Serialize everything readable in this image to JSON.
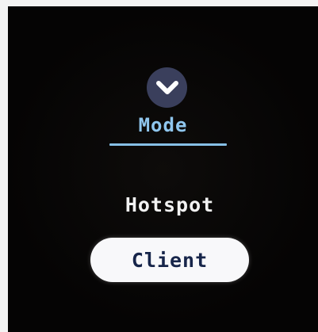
{
  "header": {
    "back_icon": "chevron-down-icon",
    "title": "Mode"
  },
  "options": [
    {
      "label": "Hotspot",
      "selected": false
    },
    {
      "label": "Client",
      "selected": true
    }
  ],
  "colors": {
    "screen_background": "#050404",
    "accent": "#8fc6ee",
    "icon_circle": "#3a3f5c",
    "selected_pill": "#f8f8fa",
    "selected_text": "#17254a",
    "unselected_text": "#f2f2f2"
  }
}
